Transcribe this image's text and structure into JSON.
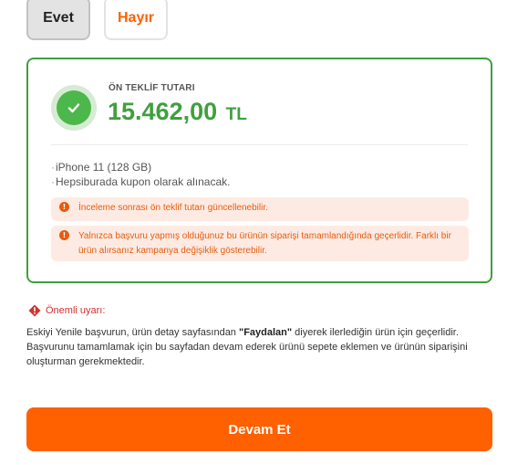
{
  "choices": {
    "yes_label": "Evet",
    "no_label": "Hayır"
  },
  "offer": {
    "label": "ÖN TEKLİF TUTARI",
    "amount": "15.462,00",
    "currency": "TL",
    "details": [
      "iPhone 11 (128 GB)",
      "Hepsiburada kupon olarak alınacak."
    ],
    "notices": [
      "İnceleme sonrası ön teklif tutarı güncellenebilir.",
      "Yalnızca başvuru yapmış olduğunuz bu ürünün siparişi tamamlandığında geçerlidir. Farklı bir ürün alırsanız kampanya değişiklik gösterebilir."
    ]
  },
  "warning": {
    "title": "Önemli uyarı:",
    "text_before": "Eskiyi Yenile başvurun, ürün detay sayfasından ",
    "text_bold": "\"Faydalan\"",
    "text_after": " diyerek ilerlediğin ürün için geçerlidir. Başvurunu tamamlamak için bu sayfadan devam ederek ürünü sepete eklemen ve ürünün siparişini oluşturman gerekmektedir."
  },
  "continue_label": "Devam Et",
  "colors": {
    "accent": "#ff6000",
    "success": "#3fa03d",
    "warning": "#ea5a0c",
    "danger": "#d3302f"
  }
}
